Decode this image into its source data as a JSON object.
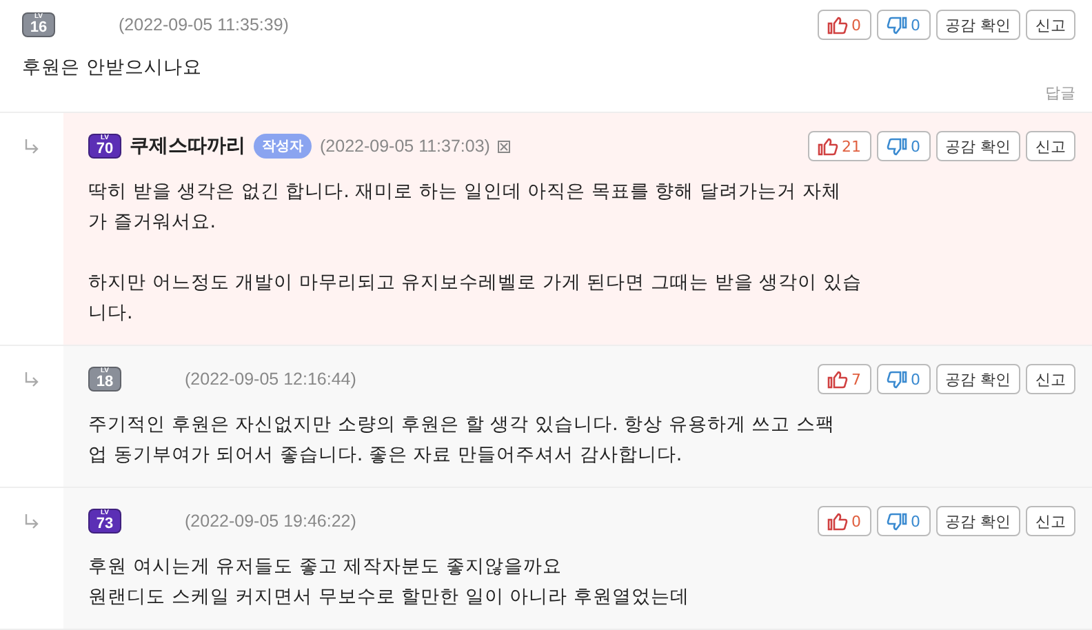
{
  "comments": [
    {
      "level_label": "LV",
      "level": "16",
      "color": "#8a8f99",
      "date": "(2022-09-05 11:35:39)",
      "flag_icon": false,
      "highlighted": false,
      "reply": false,
      "likes": "0",
      "dislikes": "0",
      "confirm": "공감 확인",
      "report": "신고",
      "paragraphs": [
        [
          "후원은 안받으시나요"
        ]
      ],
      "reply_link": "답글"
    },
    {
      "level_label": "LV",
      "level": "70",
      "color": "#5b2fb5",
      "nickname": "쿠제스따까리",
      "author_badge": "작성자",
      "date": "(2022-09-05 11:37:03)",
      "flag_icon": true,
      "highlighted": true,
      "reply": true,
      "likes": "21",
      "dislikes": "0",
      "confirm": "공감 확인",
      "report": "신고",
      "paragraphs": [
        [
          "딱히 받을 생각은 없긴 합니다. 재미로 하는 일인데 아직은 목표를 향해 달려가는거 자체",
          "가 즐거워서요."
        ],
        [
          "하지만 어느정도 개발이 마무리되고 유지보수레벨로 가게 된다면 그때는 받을 생각이 있습",
          "니다."
        ]
      ]
    },
    {
      "level_label": "LV",
      "level": "18",
      "color": "#8a8f99",
      "date": "(2022-09-05 12:16:44)",
      "flag_icon": false,
      "highlighted": false,
      "reply": true,
      "likes": "7",
      "dislikes": "0",
      "confirm": "공감 확인",
      "report": "신고",
      "paragraphs": [
        [
          "주기적인 후원은 자신없지만 소량의 후원은 할 생각 있습니다. 항상 유용하게 쓰고 스팩",
          "업 동기부여가 되어서 좋습니다. 좋은 자료 만들어주셔서 감사합니다."
        ]
      ]
    },
    {
      "level_label": "LV",
      "level": "73",
      "color": "#5b2fb5",
      "date": "(2022-09-05 19:46:22)",
      "flag_icon": false,
      "highlighted": false,
      "reply": true,
      "likes": "0",
      "dislikes": "0",
      "confirm": "공감 확인",
      "report": "신고",
      "paragraphs": [
        [
          "후원 여시는게 유저들도 좋고 제작자분도 좋지않을까요",
          "원랜디도 스케일 커지면서 무보수로 할만한 일이 아니라 후원열었는데"
        ]
      ]
    }
  ]
}
